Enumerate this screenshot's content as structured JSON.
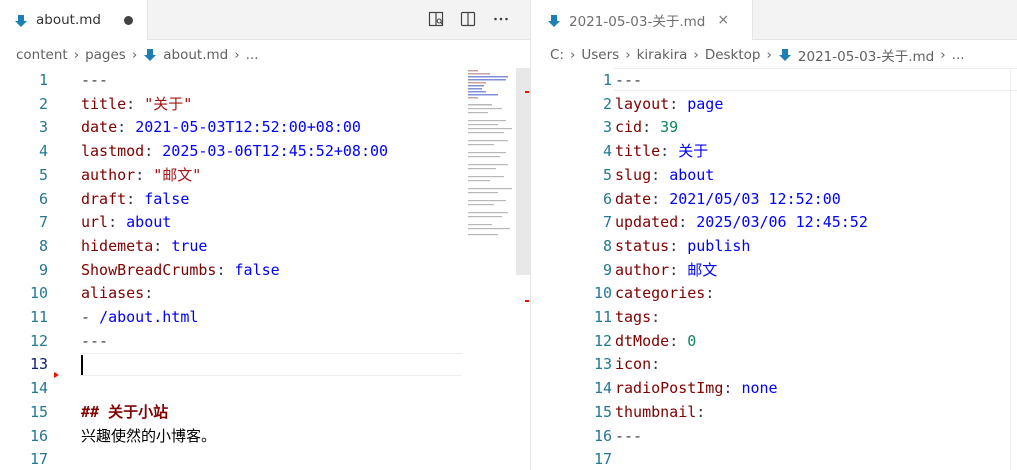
{
  "left": {
    "tab": {
      "label": "about.md",
      "icon": "markdown-icon",
      "dirty": true
    },
    "actions": [
      "open-preview-icon",
      "split-editor-icon",
      "more-actions-icon"
    ],
    "breadcrumbs": [
      "content",
      "pages",
      "about.md",
      "..."
    ],
    "lines": [
      {
        "n": "1",
        "seg": [
          [
            "---",
            "punct"
          ]
        ]
      },
      {
        "n": "2",
        "seg": [
          [
            "title",
            "key"
          ],
          [
            ": ",
            "punct"
          ],
          [
            "\"关于\"",
            "str"
          ]
        ]
      },
      {
        "n": "3",
        "seg": [
          [
            "date",
            "key"
          ],
          [
            ": ",
            "punct"
          ],
          [
            "2021-05-03T12:52:00+08:00",
            "val"
          ]
        ]
      },
      {
        "n": "4",
        "seg": [
          [
            "lastmod",
            "key"
          ],
          [
            ": ",
            "punct"
          ],
          [
            "2025-03-06T12:45:52+08:00",
            "val"
          ]
        ]
      },
      {
        "n": "5",
        "seg": [
          [
            "author",
            "key"
          ],
          [
            ": ",
            "punct"
          ],
          [
            "\"邮文\"",
            "str"
          ]
        ]
      },
      {
        "n": "6",
        "seg": [
          [
            "draft",
            "key"
          ],
          [
            ": ",
            "punct"
          ],
          [
            "false",
            "val"
          ]
        ]
      },
      {
        "n": "7",
        "seg": [
          [
            "url",
            "key"
          ],
          [
            ": ",
            "punct"
          ],
          [
            "about",
            "val"
          ]
        ]
      },
      {
        "n": "8",
        "seg": [
          [
            "hidemeta",
            "key"
          ],
          [
            ": ",
            "punct"
          ],
          [
            "true",
            "val"
          ]
        ]
      },
      {
        "n": "9",
        "seg": [
          [
            "ShowBreadCrumbs",
            "key"
          ],
          [
            ": ",
            "punct"
          ],
          [
            "false",
            "val"
          ]
        ]
      },
      {
        "n": "10",
        "seg": [
          [
            "aliases",
            "key"
          ],
          [
            ":",
            "punct"
          ]
        ]
      },
      {
        "n": "11",
        "seg": [
          [
            "- ",
            "punct"
          ],
          [
            "/about.html",
            "val"
          ]
        ]
      },
      {
        "n": "12",
        "seg": [
          [
            "---",
            "punct"
          ]
        ]
      },
      {
        "n": "13",
        "seg": []
      },
      {
        "n": "14",
        "seg": []
      },
      {
        "n": "15",
        "seg": [
          [
            "## 关于小站",
            "heading"
          ]
        ]
      },
      {
        "n": "16",
        "seg": [
          [
            "兴趣使然的小博客。",
            "plain"
          ]
        ]
      },
      {
        "n": "17",
        "seg": []
      }
    ],
    "current_line": "13"
  },
  "right": {
    "tab": {
      "label": "2021-05-03-关于.md",
      "icon": "markdown-icon",
      "close": "×"
    },
    "breadcrumbs": [
      "C:",
      "Users",
      "kirakira",
      "Desktop",
      "2021-05-03-关于.md",
      "..."
    ],
    "lines": [
      {
        "n": "1",
        "seg": [
          [
            "---",
            "punct"
          ]
        ]
      },
      {
        "n": "2",
        "seg": [
          [
            "layout",
            "key"
          ],
          [
            ": ",
            "punct"
          ],
          [
            "page",
            "val"
          ]
        ]
      },
      {
        "n": "3",
        "seg": [
          [
            "cid",
            "key"
          ],
          [
            ": ",
            "punct"
          ],
          [
            "39",
            "num"
          ]
        ]
      },
      {
        "n": "4",
        "seg": [
          [
            "title",
            "key"
          ],
          [
            ": ",
            "punct"
          ],
          [
            "关于",
            "val"
          ]
        ]
      },
      {
        "n": "5",
        "seg": [
          [
            "slug",
            "key"
          ],
          [
            ": ",
            "punct"
          ],
          [
            "about",
            "val"
          ]
        ]
      },
      {
        "n": "6",
        "seg": [
          [
            "date",
            "key"
          ],
          [
            ": ",
            "punct"
          ],
          [
            "2021/05/03 12:52:00",
            "val"
          ]
        ]
      },
      {
        "n": "7",
        "seg": [
          [
            "updated",
            "key"
          ],
          [
            ": ",
            "punct"
          ],
          [
            "2025/03/06 12:45:52",
            "val"
          ]
        ]
      },
      {
        "n": "8",
        "seg": [
          [
            "status",
            "key"
          ],
          [
            ": ",
            "punct"
          ],
          [
            "publish",
            "val"
          ]
        ]
      },
      {
        "n": "9",
        "seg": [
          [
            "author",
            "key"
          ],
          [
            ": ",
            "punct"
          ],
          [
            "邮文",
            "val"
          ]
        ]
      },
      {
        "n": "10",
        "seg": [
          [
            "categories",
            "key"
          ],
          [
            ":",
            "punct"
          ]
        ]
      },
      {
        "n": "11",
        "seg": [
          [
            "tags",
            "key"
          ],
          [
            ":",
            "punct"
          ]
        ]
      },
      {
        "n": "12",
        "seg": [
          [
            "dtMode",
            "key"
          ],
          [
            ": ",
            "punct"
          ],
          [
            "0",
            "num"
          ]
        ]
      },
      {
        "n": "13",
        "seg": [
          [
            "icon",
            "key"
          ],
          [
            ":",
            "punct"
          ]
        ]
      },
      {
        "n": "14",
        "seg": [
          [
            "radioPostImg",
            "key"
          ],
          [
            ": ",
            "punct"
          ],
          [
            "none",
            "val"
          ]
        ]
      },
      {
        "n": "15",
        "seg": [
          [
            "thumbnail",
            "key"
          ],
          [
            ":",
            "punct"
          ]
        ]
      },
      {
        "n": "16",
        "seg": [
          [
            "---",
            "punct"
          ]
        ]
      },
      {
        "n": "17",
        "seg": []
      }
    ]
  },
  "colors": {
    "line_number": "#237893",
    "key": "#800000",
    "string": "#a31515",
    "value": "#0000ff",
    "number": "#098658",
    "markdown_icon": "#1e7fb5",
    "error_marker": "#e51400"
  }
}
